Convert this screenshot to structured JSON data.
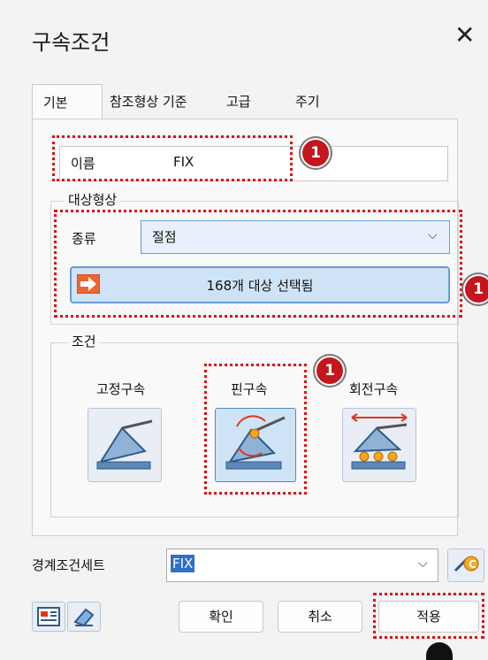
{
  "window": {
    "title": "구속조건",
    "close_icon": "close-icon"
  },
  "tabs": [
    {
      "label": "기본",
      "active": true
    },
    {
      "label": "참조형상 기준",
      "active": false
    },
    {
      "label": "고급",
      "active": false
    },
    {
      "label": "주기",
      "active": false
    }
  ],
  "name_field": {
    "label": "이름",
    "value": "FIX"
  },
  "target_group": {
    "title": "대상형상",
    "type_label": "종류",
    "type_value": "절점",
    "select_button_label": "168개 대상 선택됨"
  },
  "condition_group": {
    "title": "조건",
    "options": [
      {
        "label": "고정구속",
        "icon": "fixed-support-icon",
        "selected": false
      },
      {
        "label": "핀구속",
        "icon": "pin-support-icon",
        "selected": true
      },
      {
        "label": "회전구속",
        "icon": "roller-support-icon",
        "selected": false
      }
    ]
  },
  "bc_set": {
    "label": "경계조건세트",
    "value": "FIX"
  },
  "buttons": {
    "ok": "확인",
    "cancel": "취소",
    "apply": "적용"
  },
  "annotations": {
    "badge_number": "1"
  },
  "colors": {
    "highlight": "#d11111",
    "badge": "#c4161c",
    "accent": "#6a9bd4"
  }
}
